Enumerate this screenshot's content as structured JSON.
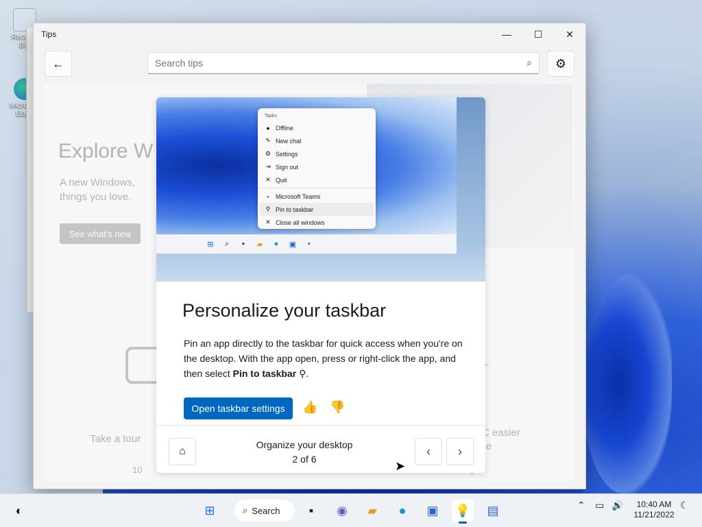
{
  "desktop": {
    "icons": [
      {
        "label": "Recycle Bin"
      },
      {
        "label": "Microsoft Edge"
      }
    ]
  },
  "window": {
    "title": "Tips",
    "minimize": "—",
    "maximize": "☐",
    "close": "✕"
  },
  "toolbar": {
    "back_icon": "←",
    "search_placeholder": "Search tips",
    "search_icon": "⌕",
    "settings_icon": "⚙"
  },
  "background_page": {
    "heading": "Explore W",
    "subtext": "A new Windows, things you love.",
    "button": "See what's new",
    "tour": "Take a tour",
    "tour_count": "10",
    "right_text": "PC easier\nuse",
    "right_count": "ps"
  },
  "card": {
    "screenshot_menu": {
      "header": "Tasks",
      "items": [
        {
          "icon": "●",
          "label": "Offline"
        },
        {
          "icon": "✎",
          "label": "New chat"
        },
        {
          "icon": "⚙",
          "label": "Settings"
        },
        {
          "icon": "⇥",
          "label": "Sign out"
        },
        {
          "icon": "✕",
          "label": "Quit"
        },
        {
          "icon": "▪",
          "label": "Microsoft Teams"
        },
        {
          "icon": "⚲",
          "label": "Pin to taskbar"
        },
        {
          "icon": "✕",
          "label": "Close all windows"
        }
      ]
    },
    "title": "Personalize your taskbar",
    "desc_part1": "Pin an app directly to the taskbar for quick access when you're on the desktop. With the app open, press or right-click the app, and then select ",
    "desc_bold": "Pin to taskbar",
    "desc_end": " ⚲.",
    "primary_button": "Open taskbar settings",
    "thumbs_up_icon": "👍",
    "thumbs_down_icon": "👎",
    "pager": {
      "home_icon": "⌂",
      "section": "Organize your desktop",
      "count": "2 of 6",
      "prev_icon": "‹",
      "next_icon": "›"
    }
  },
  "taskbar": {
    "search_label": "Search",
    "time": "10:40 AM",
    "date": "11/21/2022"
  }
}
